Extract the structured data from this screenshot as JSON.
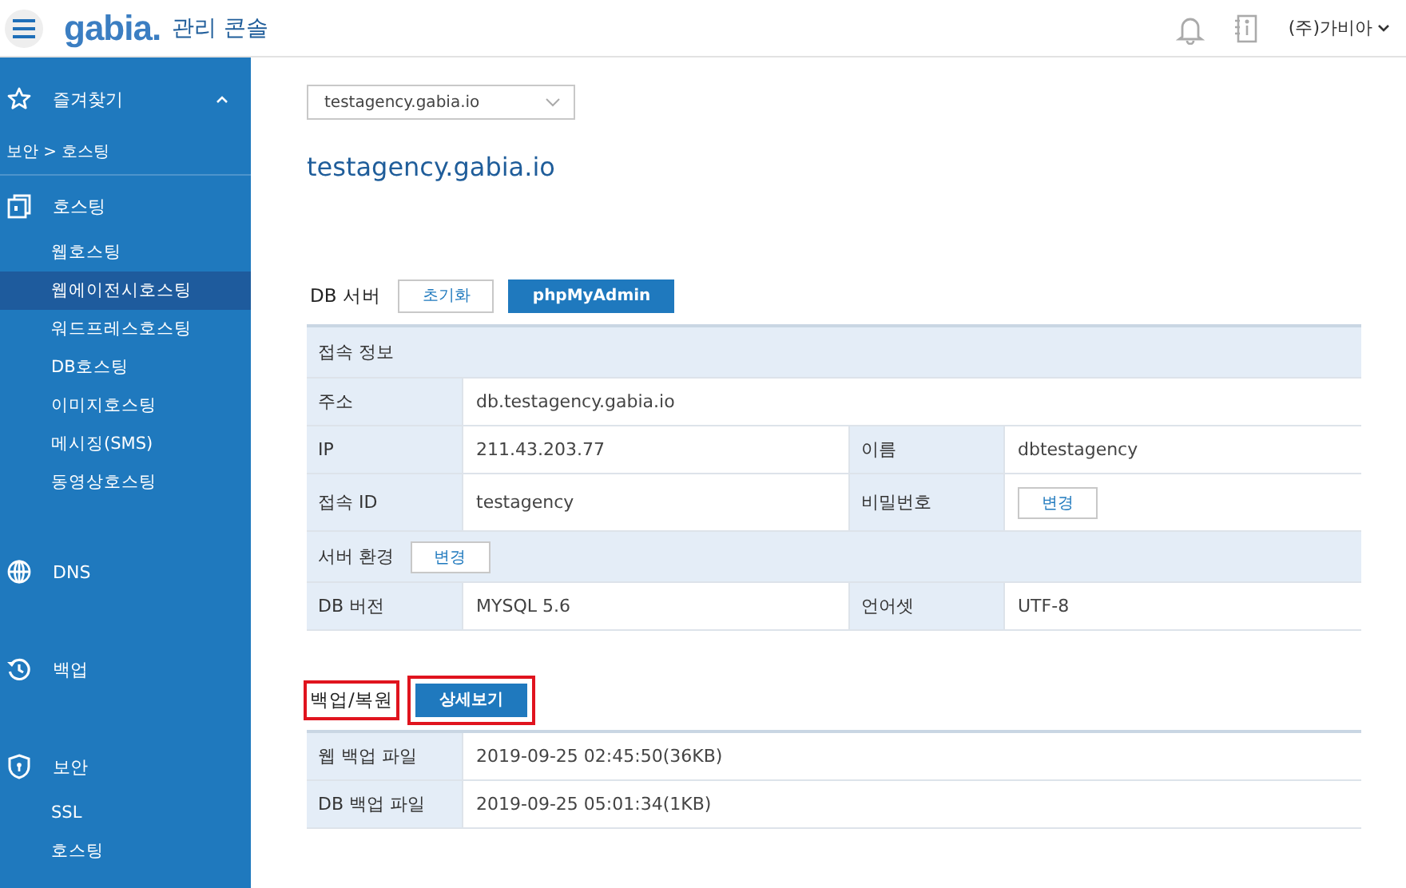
{
  "header": {
    "logo": "gabia.",
    "title": "관리 콘솔",
    "user": "(주)가비아"
  },
  "sidebar": {
    "favorites": {
      "label": "즐겨찾기",
      "expanded": true
    },
    "breadcrumb": "보안 > 호스팅",
    "groups": [
      {
        "label": "호스팅",
        "children": [
          {
            "label": "웹호스팅",
            "selected": false
          },
          {
            "label": "웹에이전시호스팅",
            "selected": true
          },
          {
            "label": "워드프레스호스팅",
            "selected": false
          },
          {
            "label": "DB호스팅",
            "selected": false
          },
          {
            "label": "이미지호스팅",
            "selected": false
          },
          {
            "label": "메시징(SMS)",
            "selected": false
          },
          {
            "label": "동영상호스팅",
            "selected": false
          }
        ]
      },
      {
        "label": "DNS"
      },
      {
        "label": "백업"
      },
      {
        "label": "보안",
        "children": [
          {
            "label": "SSL",
            "selected": false
          },
          {
            "label": "호스팅",
            "selected": false
          }
        ]
      }
    ]
  },
  "content": {
    "domain_select": "testagency.gabia.io",
    "site_title": "testagency.gabia.io",
    "db_server": {
      "title": "DB 서버",
      "buttons": [
        {
          "label": "초기화",
          "primary": false
        },
        {
          "label": "phpMyAdmin",
          "primary": true
        }
      ],
      "rows": [
        {
          "kind": "header",
          "label": "접속 정보"
        },
        {
          "kind": "full",
          "label": "주소",
          "value": "db.testagency.gabia.io"
        },
        {
          "kind": "split",
          "cells": [
            {
              "label": "IP",
              "value": "211.43.203.77"
            },
            {
              "label": "이름",
              "value": "dbtestagency"
            }
          ]
        },
        {
          "kind": "split",
          "cells": [
            {
              "label": "접속 ID",
              "value": "testagency"
            },
            {
              "label": "비밀번호",
              "button": "변경"
            }
          ]
        },
        {
          "kind": "header",
          "label": "서버 환경",
          "button": "변경"
        },
        {
          "kind": "split",
          "cells": [
            {
              "label": "DB 버전",
              "value": "MYSQL 5.6"
            },
            {
              "label": "언어셋",
              "value": "UTF-8"
            }
          ]
        }
      ]
    },
    "backup": {
      "title": "백업/복원",
      "highlighted": true,
      "button": {
        "label": "상세보기",
        "highlighted": true
      },
      "rows": [
        {
          "label": "웹 백업 파일",
          "value": "2019-09-25 02:45:50(36KB)"
        },
        {
          "label": "DB 백업 파일",
          "value": "2019-09-25 05:01:34(1KB)"
        }
      ]
    }
  }
}
